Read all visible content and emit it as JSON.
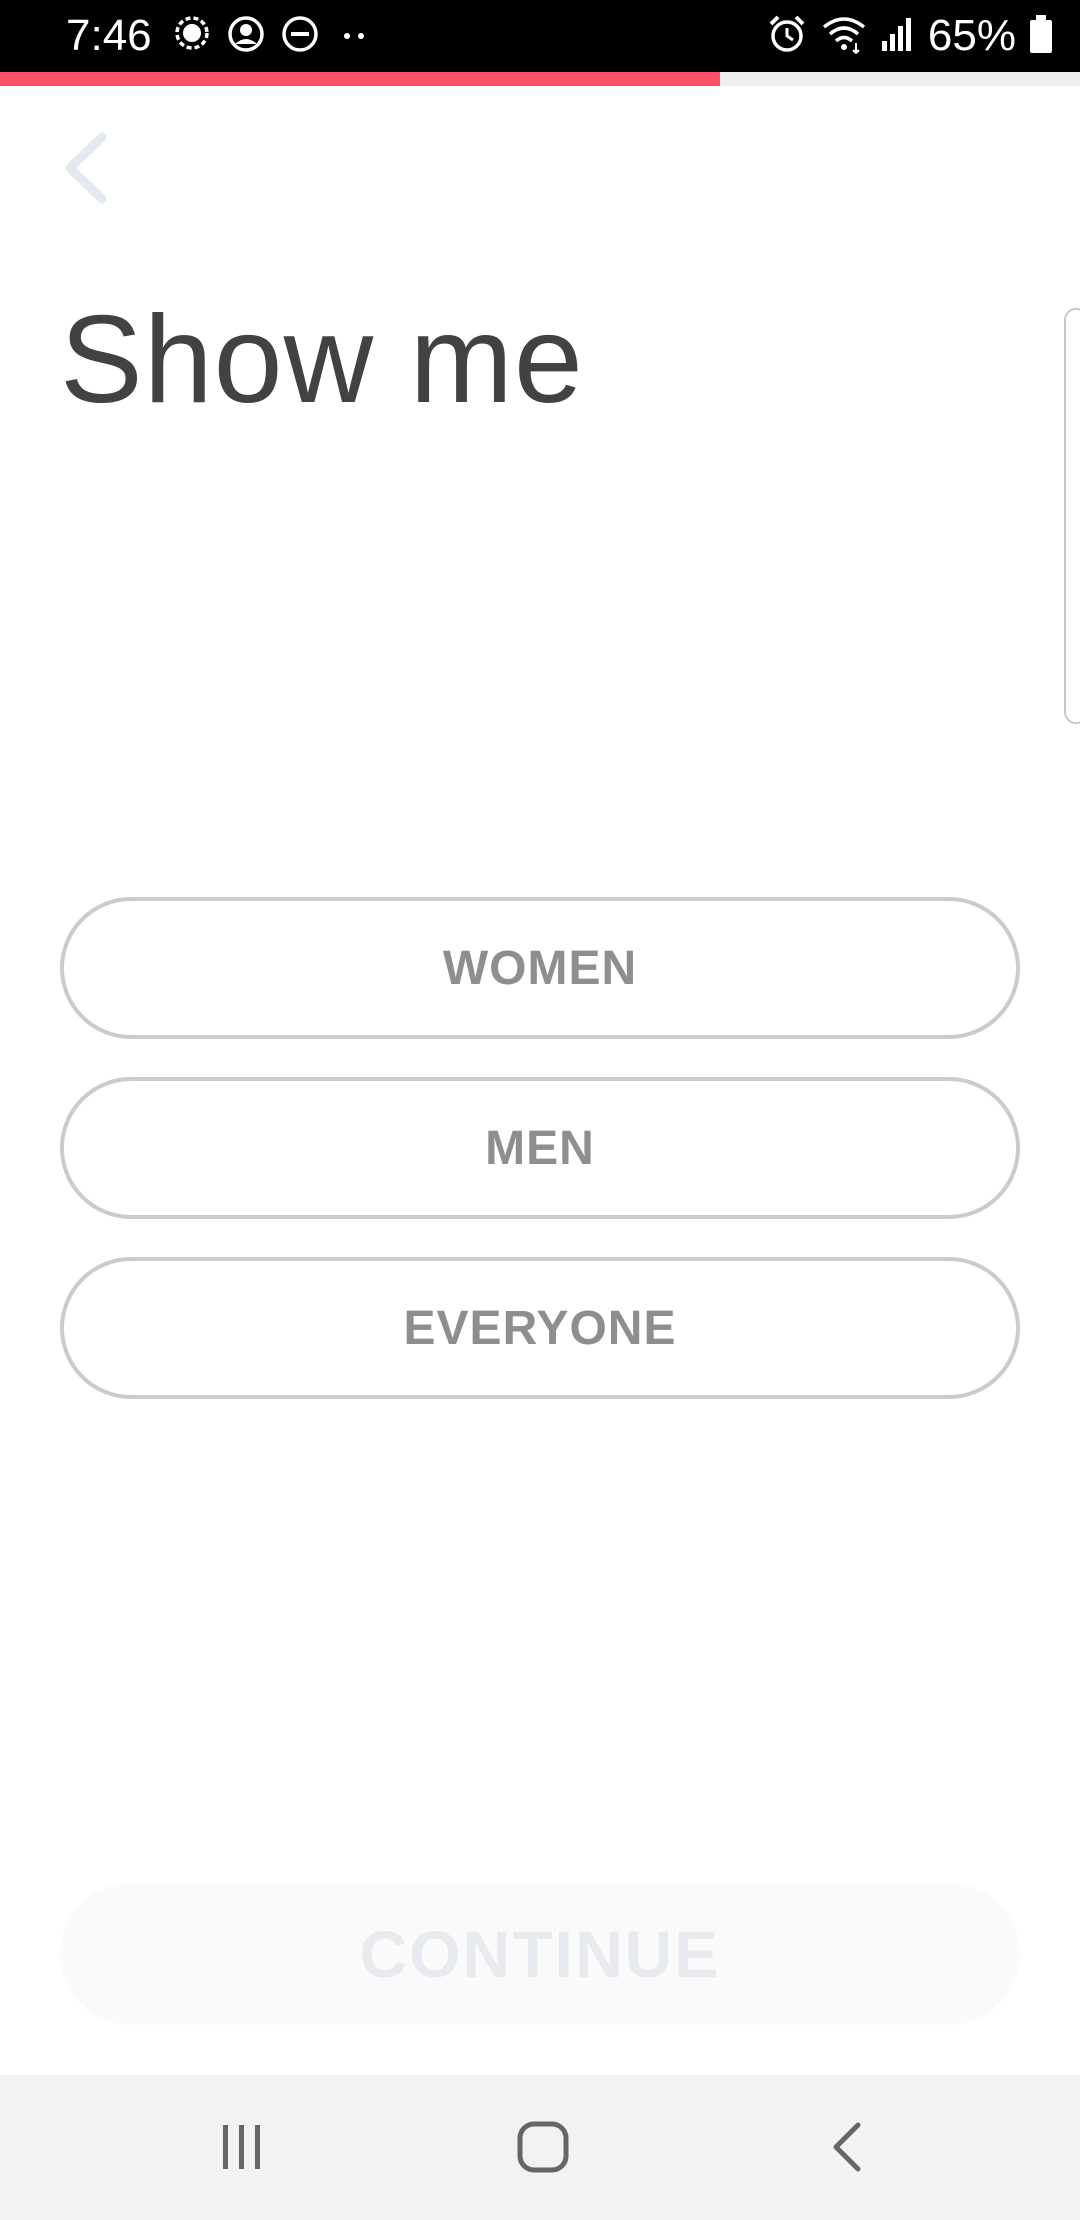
{
  "status_bar": {
    "time": "7:46",
    "battery": "65%",
    "icons_left": [
      "messenger-icon",
      "account-circle-icon",
      "do-not-disturb-icon",
      "more-dots-icon"
    ],
    "icons_right": [
      "alarm-icon",
      "wifi-icon",
      "signal-icon",
      "battery-icon"
    ]
  },
  "progress": {
    "value": 0.667,
    "color": "#fd5068"
  },
  "header": {
    "back_icon": "chevron-left-icon",
    "title": "Show me"
  },
  "options": [
    {
      "label": "WOMEN"
    },
    {
      "label": "MEN"
    },
    {
      "label": "EVERYONE"
    }
  ],
  "footer": {
    "continue_label": "CONTINUE",
    "continue_enabled": false
  },
  "nav_bar": {
    "icons": [
      "recent-apps-icon",
      "home-icon",
      "back-icon"
    ]
  }
}
